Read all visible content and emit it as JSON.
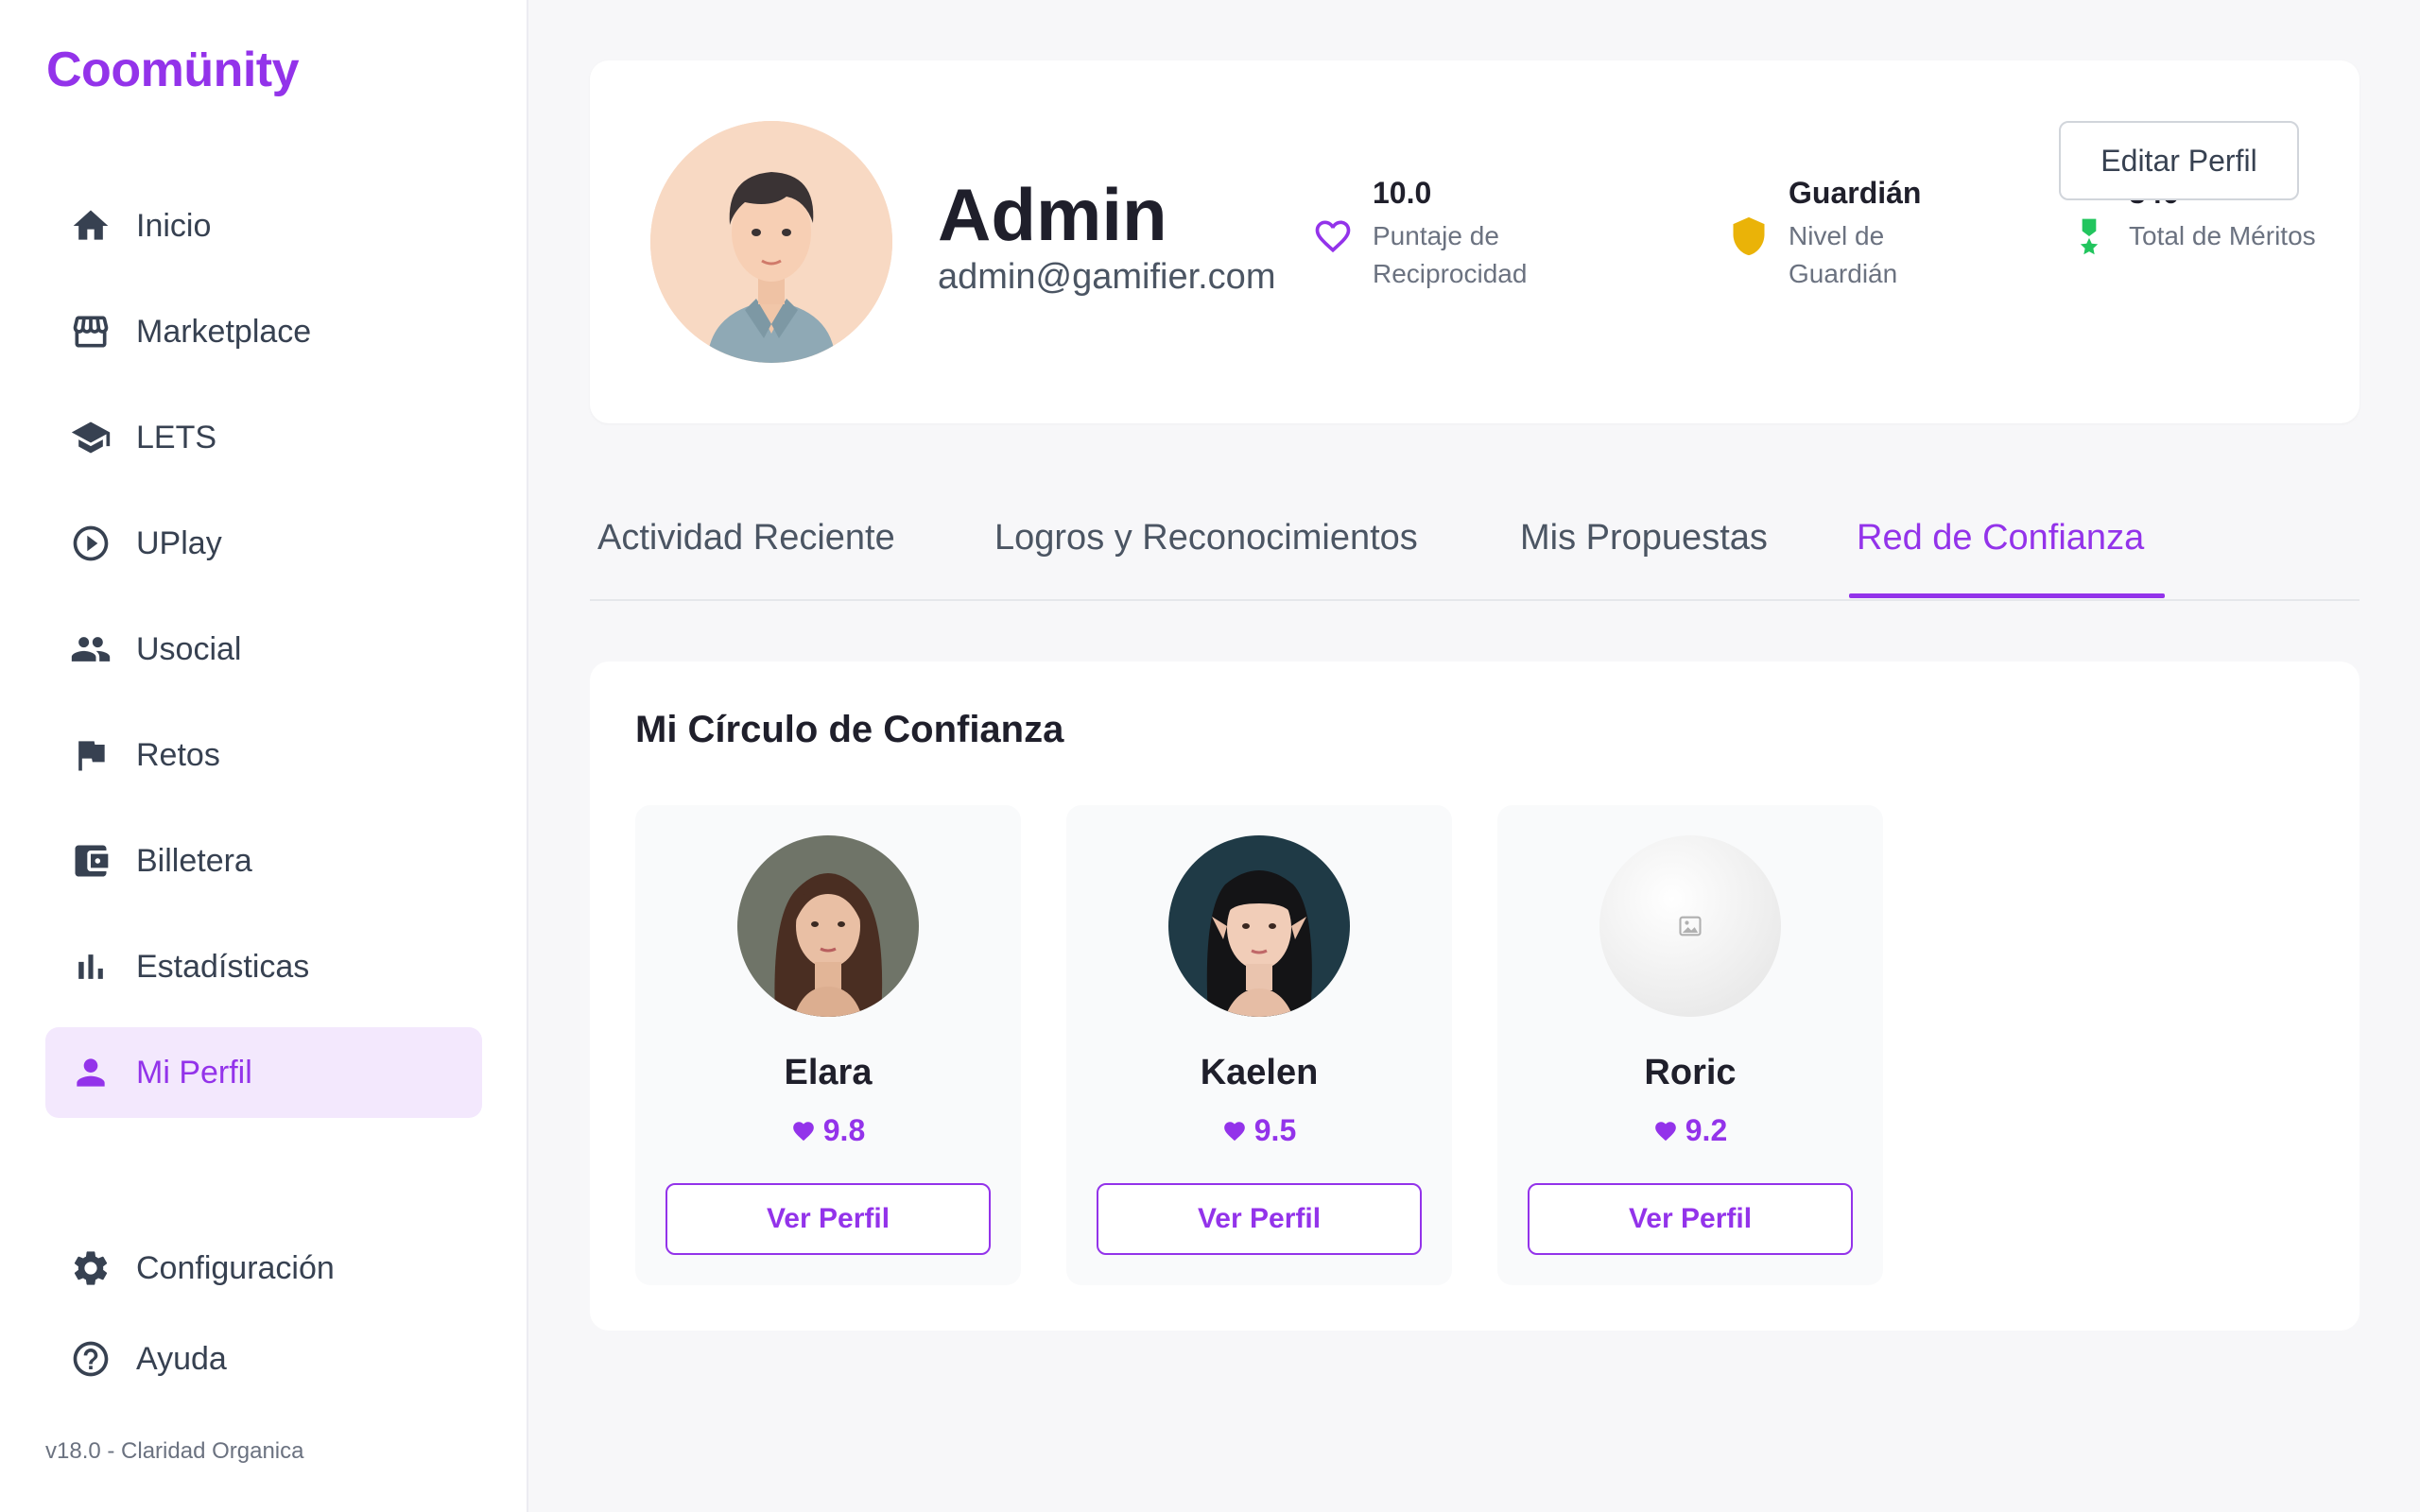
{
  "brand": "Coomünity",
  "nav": [
    {
      "label": "Inicio",
      "icon": "home-icon"
    },
    {
      "label": "Marketplace",
      "icon": "store-icon"
    },
    {
      "label": "LETS",
      "icon": "school-icon"
    },
    {
      "label": "UPlay",
      "icon": "play-circle-icon"
    },
    {
      "label": "Usocial",
      "icon": "people-icon"
    },
    {
      "label": "Retos",
      "icon": "flag-icon"
    },
    {
      "label": "Billetera",
      "icon": "wallet-icon"
    },
    {
      "label": "Estadísticas",
      "icon": "bar-chart-icon"
    },
    {
      "label": "Mi Perfil",
      "icon": "person-icon",
      "active": true
    }
  ],
  "nav_bottom": [
    {
      "label": "Configuración",
      "icon": "gear-icon"
    },
    {
      "label": "Ayuda",
      "icon": "help-icon"
    }
  ],
  "version": "v18.0 - Claridad Organica",
  "profile": {
    "name": "Admin",
    "email": "admin@gamifier.com",
    "edit_label": "Editar Perfil",
    "stats": [
      {
        "value": "10.0",
        "label": "Puntaje de Reciprocidad",
        "icon": "heart-outline-icon",
        "color": "#9333ea"
      },
      {
        "value": "Guardián",
        "label": "Nivel de Guardián",
        "icon": "shield-icon",
        "color": "#eab308"
      },
      {
        "value": "340",
        "label": "Total de Méritos",
        "icon": "medal-icon",
        "color": "#22c55e"
      }
    ]
  },
  "tabs": [
    {
      "label": "Actividad Reciente"
    },
    {
      "label": "Logros y Reconocimientos"
    },
    {
      "label": "Mis Propuestas"
    },
    {
      "label": "Red de Confianza",
      "active": true
    }
  ],
  "trust_circle": {
    "title": "Mi Círculo de Confianza",
    "members": [
      {
        "name": "Elara",
        "score": "9.8",
        "button": "Ver Perfil"
      },
      {
        "name": "Kaelen",
        "score": "9.5",
        "button": "Ver Perfil"
      },
      {
        "name": "Roric",
        "score": "9.2",
        "button": "Ver Perfil"
      }
    ]
  },
  "colors": {
    "accent": "#9333ea",
    "accent_bg": "#f3e8fd",
    "text": "#1f1f2b",
    "muted": "#6b7280"
  }
}
